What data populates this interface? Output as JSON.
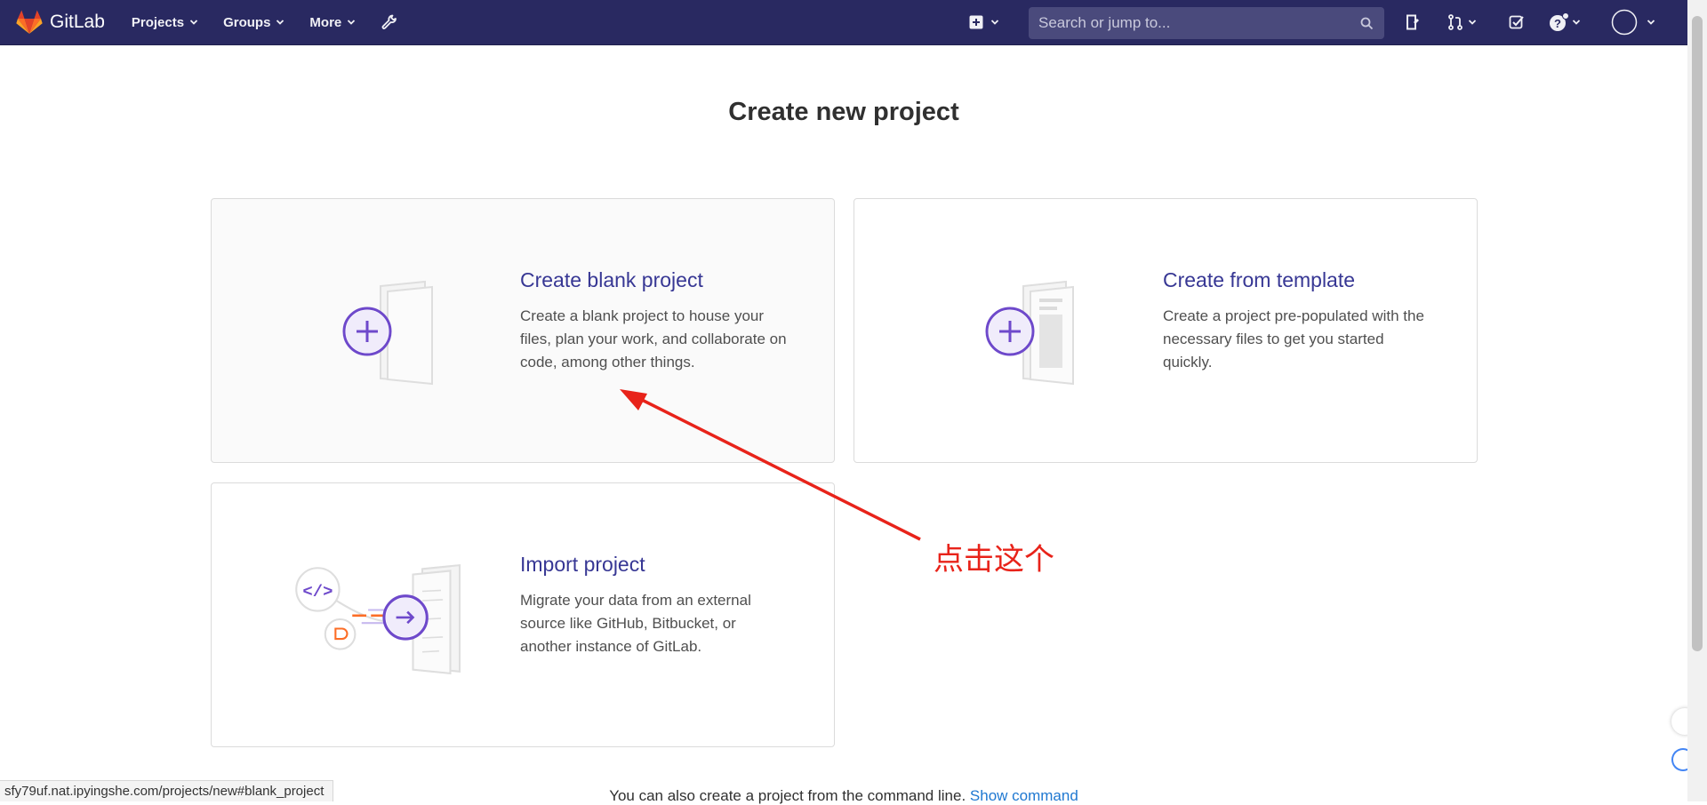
{
  "navbar": {
    "brand": "GitLab",
    "menu": [
      {
        "label": "Projects"
      },
      {
        "label": "Groups"
      },
      {
        "label": "More"
      }
    ],
    "search_placeholder": "Search or jump to..."
  },
  "page": {
    "title": "Create new project",
    "cards": [
      {
        "title": "Create blank project",
        "description": "Create a blank project to house your files, plan your work, and collaborate on code, among other things."
      },
      {
        "title": "Create from template",
        "description": "Create a project pre-populated with the necessary files to get you started quickly."
      },
      {
        "title": "Import project",
        "description": "Migrate your data from an external source like GitHub, Bitbucket, or another instance of GitLab."
      }
    ],
    "footer_text": "You can also create a project from the command line.",
    "footer_link": "Show command"
  },
  "annotation": {
    "text": "点击这个"
  },
  "status_bar": {
    "url": "sfy79uf.nat.ipyingshe.com/projects/new#blank_project"
  },
  "colors": {
    "navbar": "#292961",
    "accent": "#373794",
    "annotation": "#e8231a",
    "illustration": "#6e49cb"
  }
}
